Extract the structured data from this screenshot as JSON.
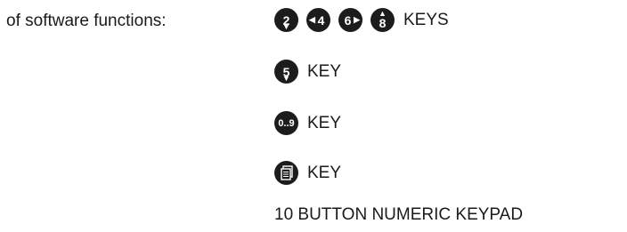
{
  "intro": "of software functions:",
  "rows": [
    {
      "keys": [
        "2",
        "4",
        "6",
        "8"
      ],
      "label": "KEYS"
    },
    {
      "keys": [
        "5"
      ],
      "label": "KEY"
    },
    {
      "keys": [
        "0..9"
      ],
      "label": "KEY"
    },
    {
      "keys": [
        "page-icon"
      ],
      "label": "KEY"
    },
    {
      "label": "10 BUTTON NUMERIC KEYPAD"
    }
  ]
}
